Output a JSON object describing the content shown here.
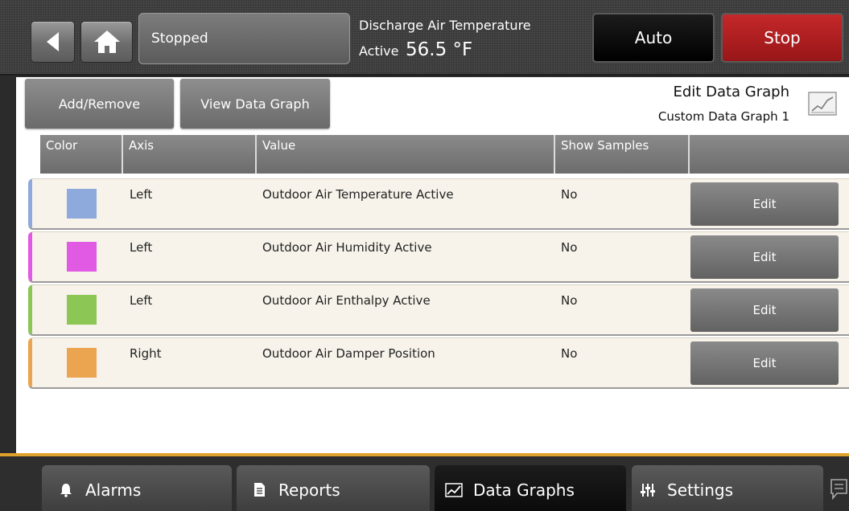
{
  "header": {
    "status": "Stopped",
    "readout_title": "Discharge Air Temperature",
    "readout_state": "Active",
    "readout_value": "56.5 °F",
    "auto_label": "Auto",
    "stop_label": "Stop"
  },
  "toolbar": {
    "add_remove": "Add/Remove",
    "view_graph": "View Data Graph",
    "title": "Edit Data Graph",
    "subtitle": "Custom Data Graph 1"
  },
  "table": {
    "columns": [
      "Color",
      "Axis",
      "Value",
      "Show Samples"
    ],
    "rows": [
      {
        "color": "#8ea9db",
        "axis": "Left",
        "value": "Outdoor Air Temperature Active",
        "samples": "No",
        "edit": "Edit"
      },
      {
        "color": "#e05ae3",
        "axis": "Left",
        "value": "Outdoor Air Humidity Active",
        "samples": "No",
        "edit": "Edit"
      },
      {
        "color": "#8cc655",
        "axis": "Left",
        "value": "Outdoor Air Enthalpy Active",
        "samples": "No",
        "edit": "Edit"
      },
      {
        "color": "#eba44f",
        "axis": "Right",
        "value": "Outdoor Air Damper Position",
        "samples": "No",
        "edit": "Edit"
      }
    ]
  },
  "nav": {
    "tabs": [
      {
        "label": "Alarms",
        "icon": "bell-icon"
      },
      {
        "label": "Reports",
        "icon": "document-icon"
      },
      {
        "label": "Data Graphs",
        "icon": "chart-icon"
      },
      {
        "label": "Settings",
        "icon": "sliders-icon"
      }
    ]
  },
  "colors": {
    "accent": "#e0a12c",
    "stop": "#c4282a"
  }
}
